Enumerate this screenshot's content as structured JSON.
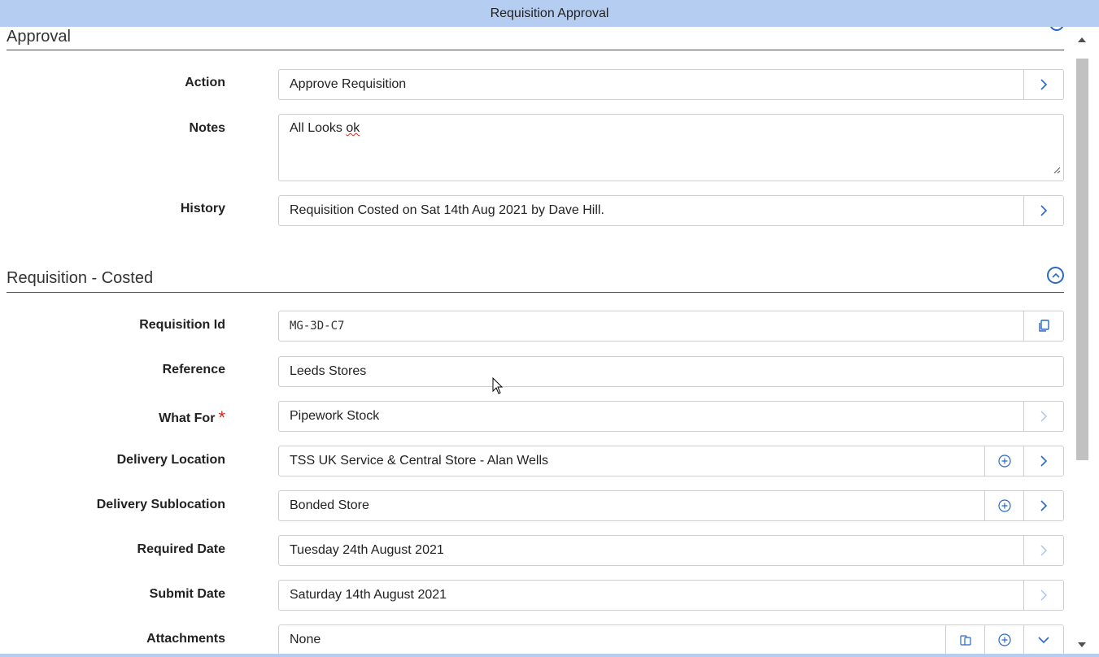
{
  "window": {
    "title": "Requisition Approval"
  },
  "approval": {
    "heading": "Approval",
    "action_label": "Action",
    "action_value": "Approve Requisition",
    "notes_label": "Notes",
    "notes_value_prefix": "All Looks ",
    "notes_value_misspelled": "ok",
    "history_label": "History",
    "history_value": "Requisition Costed on Sat 14th Aug 2021 by Dave Hill."
  },
  "requisition": {
    "heading": "Requisition - Costed",
    "id_label": "Requisition Id",
    "id_value": "MG-3D-C7",
    "reference_label": "Reference",
    "reference_value": "Leeds Stores",
    "what_for_label": "What For",
    "required_marker": "*",
    "what_for_value": "Pipework Stock",
    "delivery_location_label": "Delivery Location",
    "delivery_location_value": "TSS UK Service & Central Store - Alan Wells",
    "delivery_sublocation_label": "Delivery Sublocation",
    "delivery_sublocation_value": "Bonded Store",
    "required_date_label": "Required Date",
    "required_date_value": "Tuesday 24th August 2021",
    "submit_date_label": "Submit Date",
    "submit_date_value": "Saturday 14th August 2021",
    "attachments_label": "Attachments",
    "attachments_value": "None"
  },
  "colors": {
    "accent": "#2a68c8",
    "titlebar": "#b4cdf0",
    "section_rule": "#1f5963",
    "required": "#d0271d",
    "disabled_icon": "#a9c4ec"
  },
  "icons": [
    "collapse-up-icon",
    "chevron-right-icon",
    "copy-icon",
    "add-circle-icon",
    "chevron-down-icon",
    "resize-grip-icon",
    "mouse-cursor-icon"
  ]
}
